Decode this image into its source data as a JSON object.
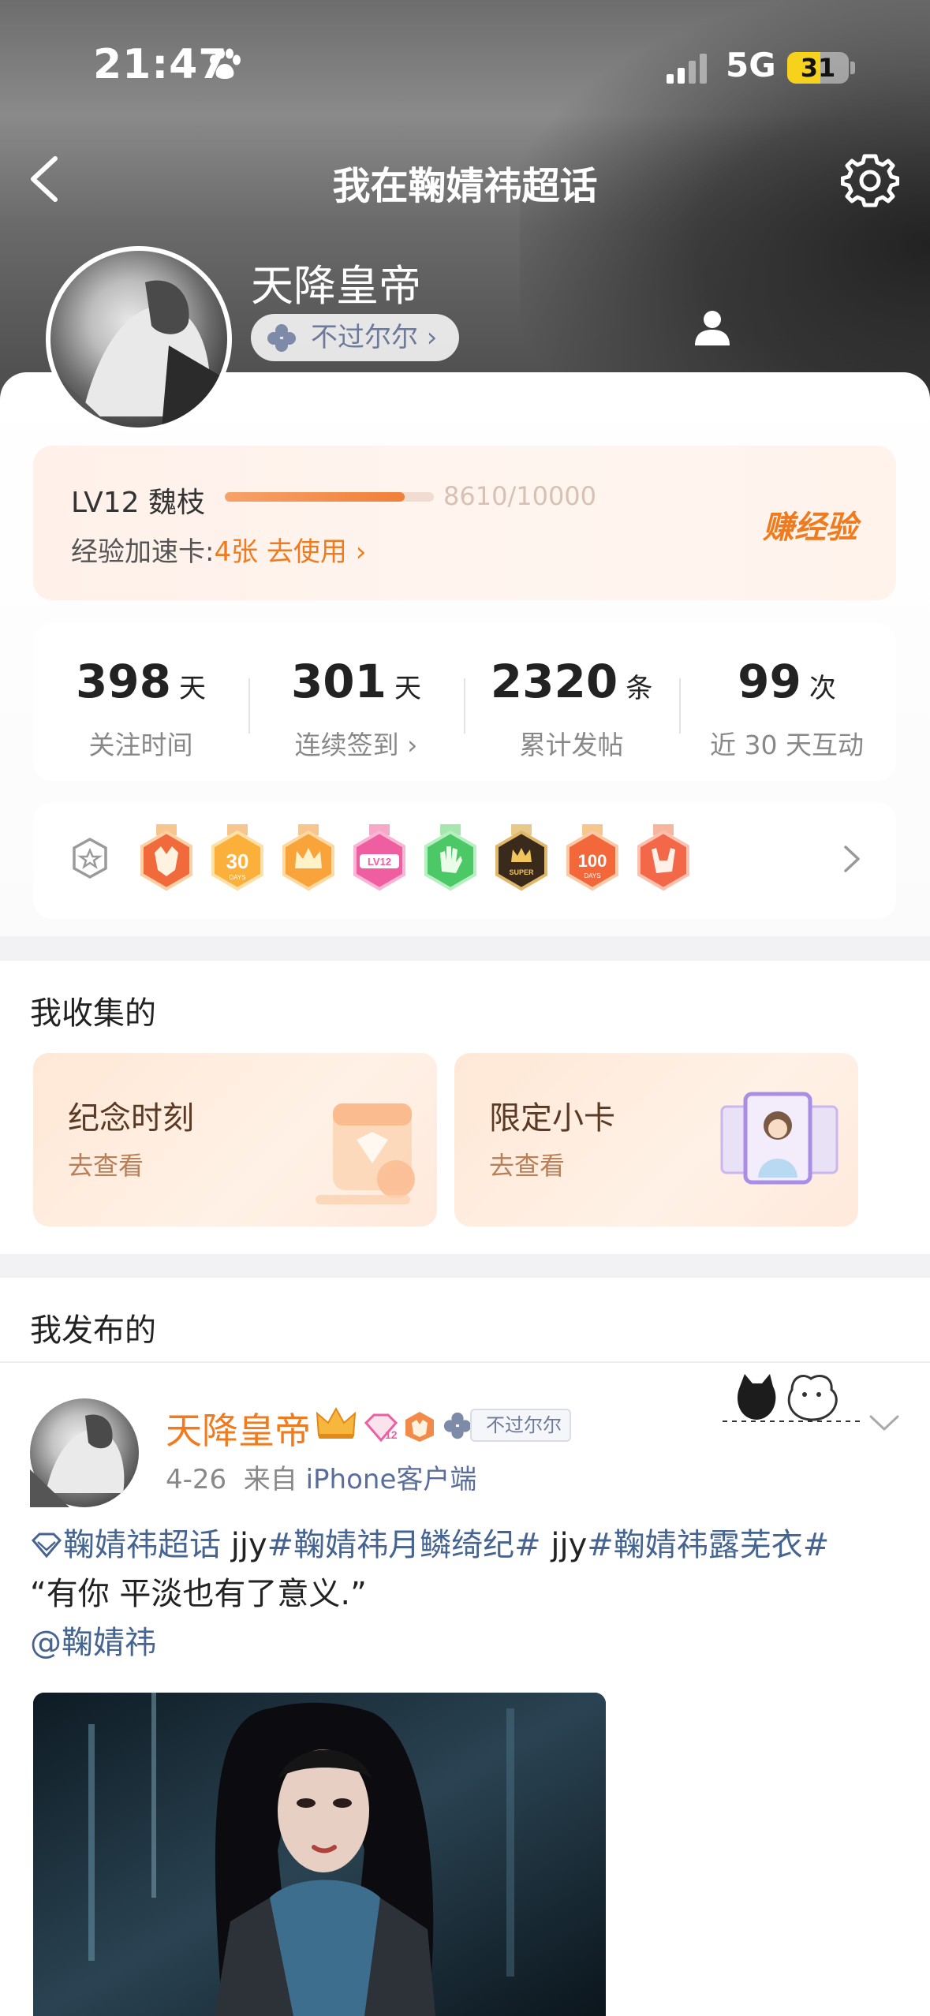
{
  "status_bar": {
    "time": "21:47",
    "network": "5G",
    "battery": "31"
  },
  "nav": {
    "title": "我在鞠婧祎超话"
  },
  "profile": {
    "name": "天降皇帝",
    "tag": "不过尔尔 ›"
  },
  "level": {
    "label": "LV12 魏枝",
    "progress_text": "8610/10000",
    "progress": 0.861,
    "accel_label": "经验加速卡:",
    "accel_value": "4张 去使用 ›",
    "earn": "赚经验"
  },
  "stats": [
    {
      "value": "398",
      "unit": "天",
      "label": "关注时间"
    },
    {
      "value": "301",
      "unit": "天",
      "label": "连续签到 ›"
    },
    {
      "value": "2320",
      "unit": "条",
      "label": "累计发帖"
    },
    {
      "value": "99",
      "unit": "次",
      "label": "近 30 天互动"
    }
  ],
  "badges": {
    "items": [
      "fox-badge",
      "30-days-badge",
      "crown-badge",
      "lv12-badge",
      "hand-badge",
      "super-badge",
      "100-days-badge",
      "rock-hand-badge"
    ],
    "texts": {
      "days30": "30",
      "days30_sub": "DAYS",
      "lv": "LV12",
      "super": "SUPER",
      "days100": "100",
      "days100_sub": "DAYS"
    }
  },
  "collection": {
    "title": "我收集的",
    "cards": [
      {
        "title": "纪念时刻",
        "sub": "去查看"
      },
      {
        "title": "限定小卡",
        "sub": "去查看"
      }
    ]
  },
  "posts_section": {
    "title": "我发布的"
  },
  "post": {
    "author": "天降皇帝",
    "level_badge": "12",
    "tag": "不过尔尔",
    "date": "4-26",
    "source_prefix": "来自",
    "source": "iPhone客户端",
    "line1_topic": "鞠婧祎超话",
    "line1_a": " jjy",
    "line1_b": "#鞠婧祎月鳞绮纪#",
    "line1_c": " jjy",
    "line1_d": "#鞠婧祎露芜衣#",
    "line2": "“有你 平淡也有了意义.”",
    "mention": "@鞠婧祎"
  },
  "colors": {
    "accent_orange": "#f07b1f",
    "link_blue": "#466491",
    "header_gray": "#6d6d6d"
  }
}
